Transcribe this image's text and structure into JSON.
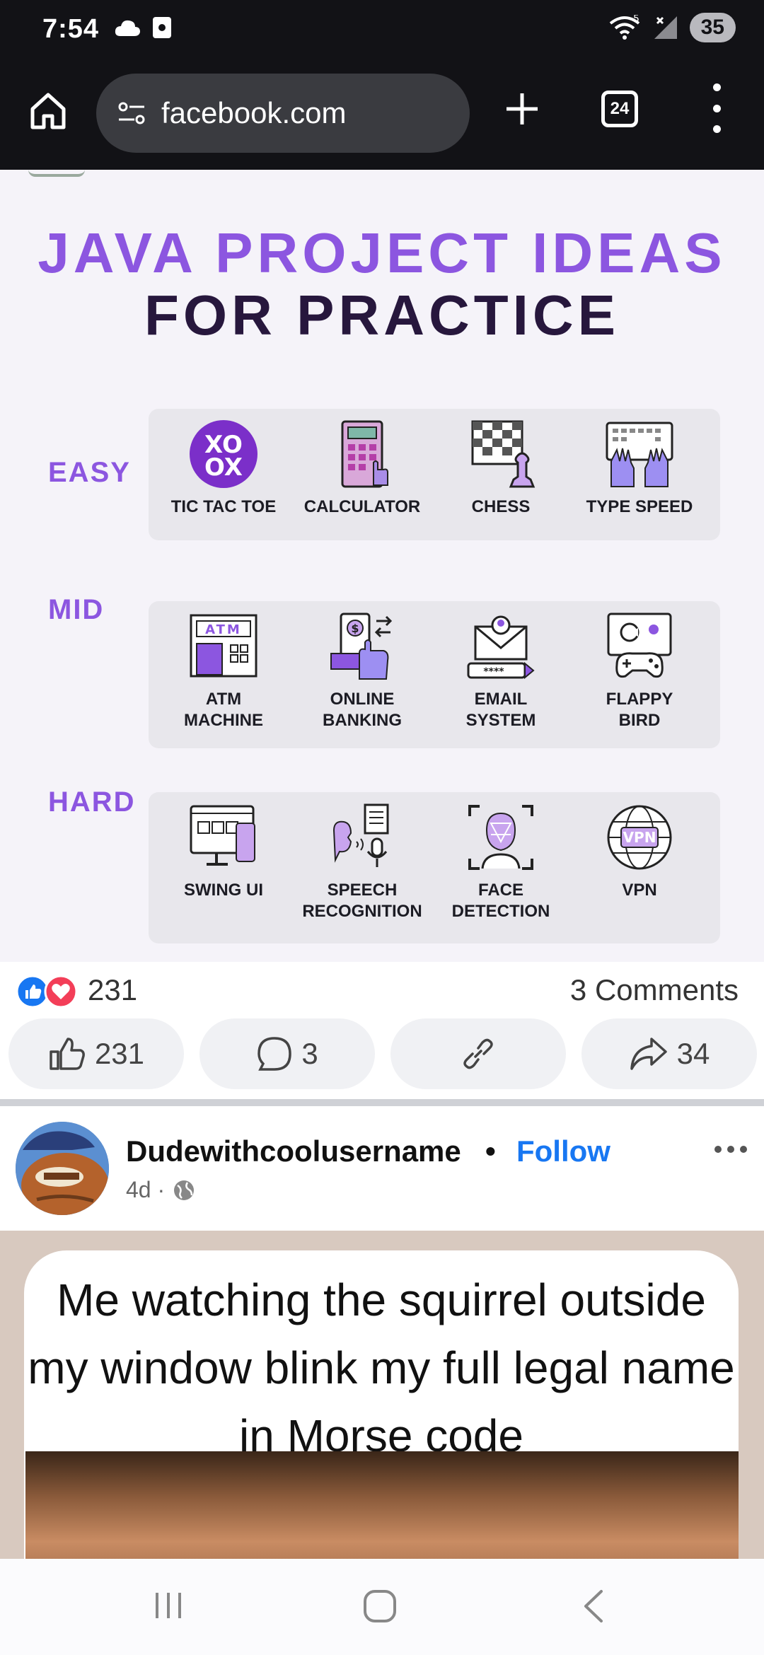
{
  "status_bar": {
    "time": "7:54",
    "signal_badge": "5",
    "battery": "35"
  },
  "browser": {
    "url": "facebook.com",
    "tab_count": "24"
  },
  "infographic": {
    "title_line1": "JAVA PROJECT IDEAS",
    "title_line2": "FOR PRACTICE",
    "accent_color": "#8c56e0",
    "levels": [
      {
        "label": "EASY",
        "items": [
          {
            "label": "TIC TAC TOE",
            "icon": "tic-tac-toe-icon"
          },
          {
            "label": "CALCULATOR",
            "icon": "calculator-icon"
          },
          {
            "label": "CHESS",
            "icon": "chess-icon"
          },
          {
            "label": "TYPE SPEED",
            "icon": "keyboard-icon"
          }
        ]
      },
      {
        "label": "MID",
        "items": [
          {
            "label": "ATM\nMACHINE",
            "icon": "atm-icon",
            "sign": "ATM"
          },
          {
            "label": "ONLINE\nBANKING",
            "icon": "online-banking-icon"
          },
          {
            "label": "EMAIL\nSYSTEM",
            "icon": "email-icon",
            "mask": "****"
          },
          {
            "label": "FLAPPY\nBIRD",
            "icon": "game-controller-icon"
          }
        ]
      },
      {
        "label": "HARD",
        "items": [
          {
            "label": "SWING UI",
            "icon": "swing-ui-icon"
          },
          {
            "label": "SPEECH\nRECOGNITION",
            "icon": "speech-icon"
          },
          {
            "label": "FACE\nDETECTION",
            "icon": "face-scan-icon"
          },
          {
            "label": "VPN",
            "icon": "vpn-globe-icon",
            "badge": "VPN"
          }
        ]
      }
    ]
  },
  "reactions": {
    "count": "231",
    "comments": "3 Comments"
  },
  "actions": {
    "like": "231",
    "comment": "3",
    "share": "34"
  },
  "post": {
    "author": "Dudewithcoolusername",
    "separator": "•",
    "follow": "Follow",
    "time": "4d ·",
    "meme_text": "Me watching the squirrel outside my window blink my full legal name in Morse code"
  },
  "colors": {
    "facebook_blue": "#1877f2",
    "browser_bg": "#121216"
  }
}
